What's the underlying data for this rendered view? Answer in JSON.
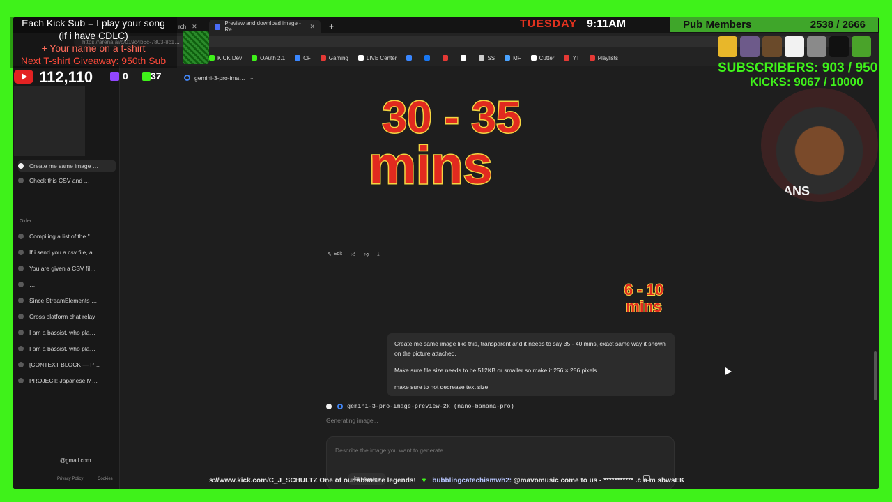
{
  "browser": {
    "tabs": [
      {
        "label": "rch",
        "active": false
      },
      {
        "label": "Preview and download image - Re",
        "active": true
      }
    ],
    "url": "https://arena.ai/c/019c4b6c-7803-8c1…",
    "url_suffix": "1232f",
    "bookmarks": [
      {
        "label": "KICK Dev",
        "color": "#3ff21a"
      },
      {
        "label": "OAuth 2.1",
        "color": "#3ff21a"
      },
      {
        "label": "CF",
        "color": "#3a87ff"
      },
      {
        "label": "Gaming",
        "color": "#e53935"
      },
      {
        "label": "LIVE Center",
        "color": "#ffffff"
      },
      {
        "label": "",
        "color": "#3a87ff"
      },
      {
        "label": "",
        "color": "#1877f2"
      },
      {
        "label": "",
        "color": "#e53935"
      },
      {
        "label": "",
        "color": "#ffffff"
      },
      {
        "label": "SS",
        "color": "#cccccc"
      },
      {
        "label": "MF",
        "color": "#4aa3ff"
      },
      {
        "label": "Cutter",
        "color": "#ffffff"
      },
      {
        "label": "YT",
        "color": "#e53935"
      },
      {
        "label": "Playlists",
        "color": "#e53935"
      }
    ]
  },
  "model_selector": {
    "label": "gemini-3-pro-ima…"
  },
  "sidebar": {
    "recent": [
      {
        "label": "Create me same image …",
        "active": true
      },
      {
        "label": "Check this CSV and …",
        "active": false
      }
    ],
    "older_label": "Older",
    "older": [
      {
        "label": "Compiling a list of the \"…"
      },
      {
        "label": "If i send you a csv file, a…"
      },
      {
        "label": "You are given a CSV fil…"
      },
      {
        "label": "…"
      },
      {
        "label": "Since StreamElements …"
      },
      {
        "label": "Cross platform chat relay"
      },
      {
        "label": "I am a bassist, who pla…"
      },
      {
        "label": "I am a bassist, who pla…"
      },
      {
        "label": "[CONTEXT BLOCK — P…"
      },
      {
        "label": "PROJECT: Japanese M…"
      }
    ],
    "account_email": "@gmail.com",
    "privacy": "Privacy Policy",
    "cookies": "Cookies"
  },
  "generated_image": {
    "line1": "30 - 35",
    "line2": "mins"
  },
  "reference_image": {
    "line1": "6 - 10",
    "line2": "mins"
  },
  "message_actions": {
    "edit": "Edit"
  },
  "user_prompt": {
    "p1": "Create me same image like this, transparent and it needs to say 35 - 40 mins, exact same way it shown on the picture attached.",
    "p2": "Make sure file size needs to be 512KB or smaller so make it 256 × 256 pixels",
    "p3": "make sure to not decrease text size"
  },
  "response": {
    "model": "gemini-3-pro-image-preview-2k (nano-banana-pro)",
    "status": "Generating image..."
  },
  "composer": {
    "placeholder": "Describe the image you want to generate...",
    "mode_label": "Image"
  },
  "overlay": {
    "kick_sub": {
      "line1": "Each Kick Sub = I play your song",
      "line2": "(if i have CDLC)",
      "line3": "+ Your name on a t-shirt",
      "line4": "Next T-shirt Giveaway: 950th Sub"
    },
    "youtube_count": "112,110",
    "twitch_count": "0",
    "kick_count": "37",
    "day": "TUESDAY",
    "time": "9:11AM",
    "pub_label": "Pub Members",
    "pub_count": "2538 / 2666",
    "subscribers": "SUBSCRIBERS: 903 / 950",
    "kicks": "KICKS: 9067 / 10000",
    "webcam_shirt": "ANS",
    "ticker_link": "s://www.kick.com/C_J_SCHULTZ One of our absolute legends!",
    "ticker_user": "bubblingcatechismwh2:",
    "ticker_msg": "@mavomusic come to us - *********** .c o m sbwsEK"
  },
  "colors": {
    "accent_red": "#e12a1f",
    "accent_yellow": "#f4d541",
    "chroma_green": "#3ff21a"
  }
}
